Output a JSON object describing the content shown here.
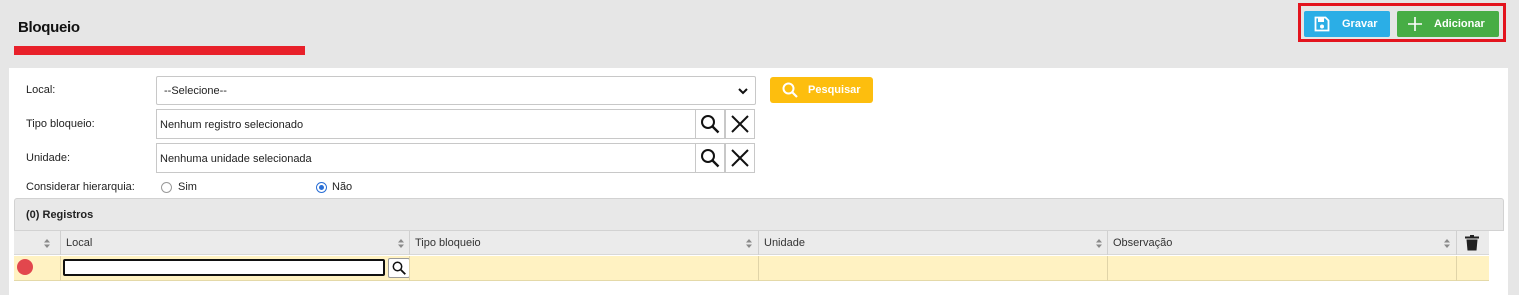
{
  "page": {
    "title": "Bloqueio"
  },
  "toolbar": {
    "save_label": "Gravar",
    "add_label": "Adicionar"
  },
  "form": {
    "local": {
      "label": "Local:",
      "value": "--Selecione--"
    },
    "search_label": "Pesquisar",
    "tipo_bloqueio": {
      "label": "Tipo bloqueio:",
      "value": "Nenhum registro selecionado"
    },
    "unidade": {
      "label": "Unidade:",
      "value": "Nenhuma unidade selecionada"
    },
    "hierarquia": {
      "label": "Considerar hierarquia:",
      "options": [
        {
          "label": "Sim",
          "checked": false
        },
        {
          "label": "Não",
          "checked": true
        }
      ]
    }
  },
  "grid": {
    "title": "(0) Registros",
    "columns": [
      "Local",
      "Tipo bloqueio",
      "Unidade",
      "Observação"
    ],
    "row": {
      "status": "error",
      "local_value": ""
    }
  },
  "colors": {
    "accent_red": "#e8202a",
    "save_blue": "#2baee6",
    "add_green": "#47ad45",
    "search_yellow": "#fdbe0e",
    "row_highlight": "#fff2c2",
    "status_red": "#e2474d"
  },
  "icons": [
    "floppy-disk-icon",
    "plus-icon",
    "search-icon",
    "close-icon",
    "chevron-down-icon",
    "sort-icon",
    "trash-icon"
  ]
}
